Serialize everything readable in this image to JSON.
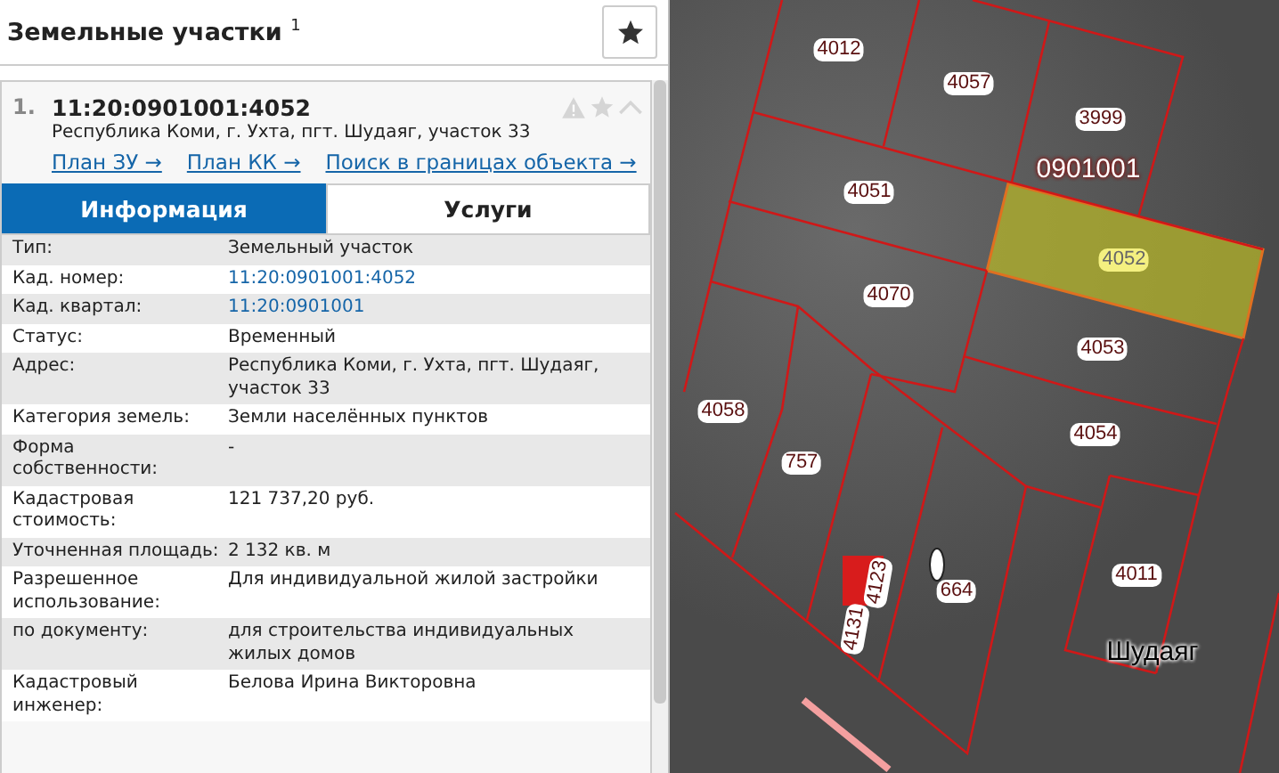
{
  "panel": {
    "title": "Земельные участки $^{1}$"
  },
  "result": {
    "index": "1.",
    "number": "11:20:0901001:4052",
    "address": "Республика Коми, г. Ухта, пгт. Шудаяг, участок 33",
    "links": [
      "План ЗУ →",
      "План КК →",
      "Поиск в границах объекта →"
    ]
  },
  "tabs": [
    {
      "label": "Информация",
      "selected": true
    },
    {
      "label": "Услуги",
      "selected": false
    }
  ],
  "properties": [
    {
      "label": "Тип:",
      "value": "Земельный участок",
      "kind": "text"
    },
    {
      "label": "Кад. номер:",
      "value": "11:20:0901001:4052",
      "kind": "link"
    },
    {
      "label": "Кад. квартал:",
      "value": "11:20:0901001",
      "kind": "link"
    },
    {
      "label": "Статус:",
      "value": "Временный",
      "kind": "text"
    },
    {
      "label": "Адрес:",
      "value": "Республика Коми, г. Ухта, пгт. Шудаяг, участок 33",
      "kind": "text"
    },
    {
      "label": "Категория земель:",
      "value": "Земли населённых пунктов",
      "kind": "text"
    },
    {
      "label": "Форма собственности:",
      "value": "-",
      "kind": "text"
    },
    {
      "label": "Кадастровая стоимость:",
      "value": "121 737,20 руб.",
      "kind": "text"
    },
    {
      "label": "Уточненная площадь:",
      "value": "2 132 кв. м",
      "kind": "text"
    },
    {
      "label": "Разрешенное использование:",
      "value": "Для индивидуальной жилой застройки",
      "kind": "text"
    },
    {
      "label": "по документу:",
      "value": "для строительства индивидуальных жилых домов",
      "kind": "text"
    },
    {
      "label": "Кадастровый инженер:",
      "value": "Белова Ирина Викторовна",
      "kind": "text"
    }
  ],
  "map": {
    "labels": [
      {
        "text": "4012",
        "kind": "parcel"
      },
      {
        "text": "4057",
        "kind": "parcel"
      },
      {
        "text": "3999",
        "kind": "parcel"
      },
      {
        "text": "0901001",
        "kind": "quarter"
      },
      {
        "text": "4051",
        "kind": "parcel"
      },
      {
        "text": "4052",
        "kind": "selected"
      },
      {
        "text": "4070",
        "kind": "parcel"
      },
      {
        "text": "4053",
        "kind": "parcel"
      },
      {
        "text": "4058",
        "kind": "parcel"
      },
      {
        "text": "757",
        "kind": "parcel"
      },
      {
        "text": "4054",
        "kind": "parcel"
      },
      {
        "text": "4123",
        "kind": "vertical"
      },
      {
        "text": "4131",
        "kind": "vertical"
      },
      {
        "text": "664",
        "kind": "parcel"
      },
      {
        "text": "4011",
        "kind": "parcel"
      },
      {
        "text": "Шудаяг",
        "kind": "place"
      }
    ]
  }
}
